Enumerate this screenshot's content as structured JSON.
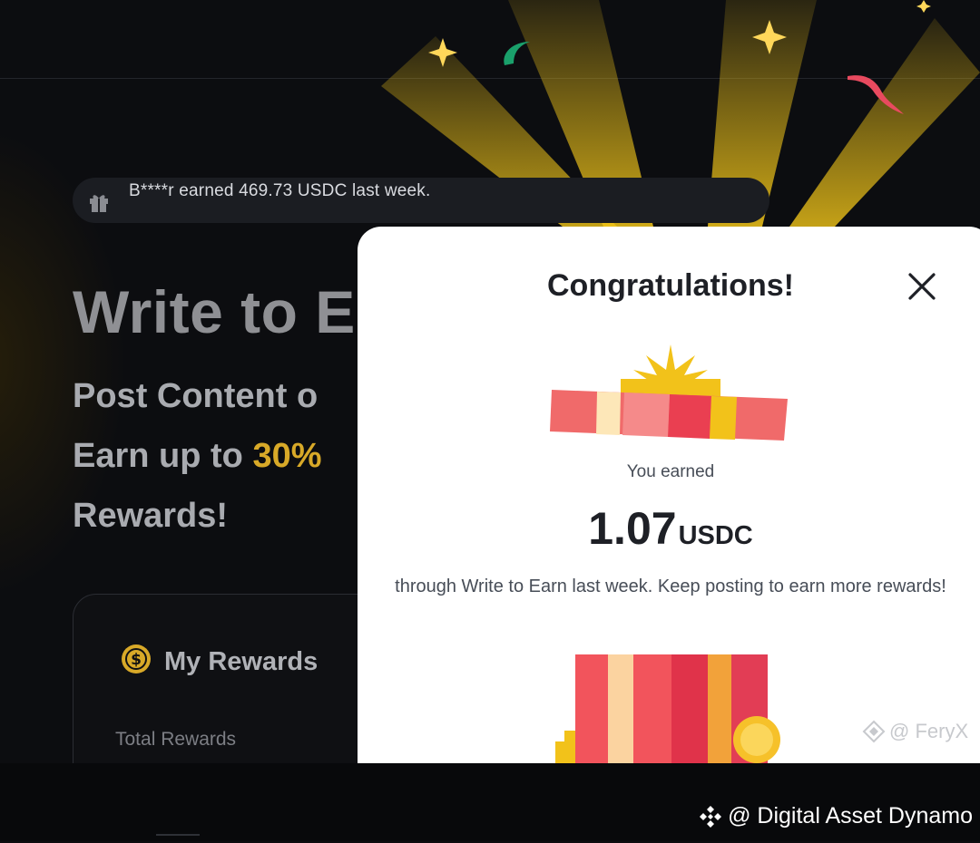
{
  "ticker": {
    "text": "B****r earned 469.73 USDC last week."
  },
  "hero": {
    "title": "Write to E",
    "line1": "Post Content o",
    "line2_prefix": "Earn up to ",
    "line2_accent": "30%",
    "line3": "Rewards!"
  },
  "rewards_card": {
    "title": "My Rewards",
    "total_label": "Total Rewards"
  },
  "modal": {
    "title": "Congratulations!",
    "earned_label": "You earned",
    "amount": "1.07",
    "currency": "USDC",
    "description": "through Write to Earn last week. Keep posting to earn more rewards!",
    "credit": "@ FeryX"
  },
  "watermark": {
    "text": "@ Digital Asset Dynamo"
  },
  "icons": [
    "gift-icon",
    "dollar-coin-icon",
    "close-icon",
    "diamond-logo-icon"
  ],
  "colors": {
    "accent": "#d8a928",
    "modal_bg": "#ffffff",
    "page_bg": "#0c0d10"
  }
}
